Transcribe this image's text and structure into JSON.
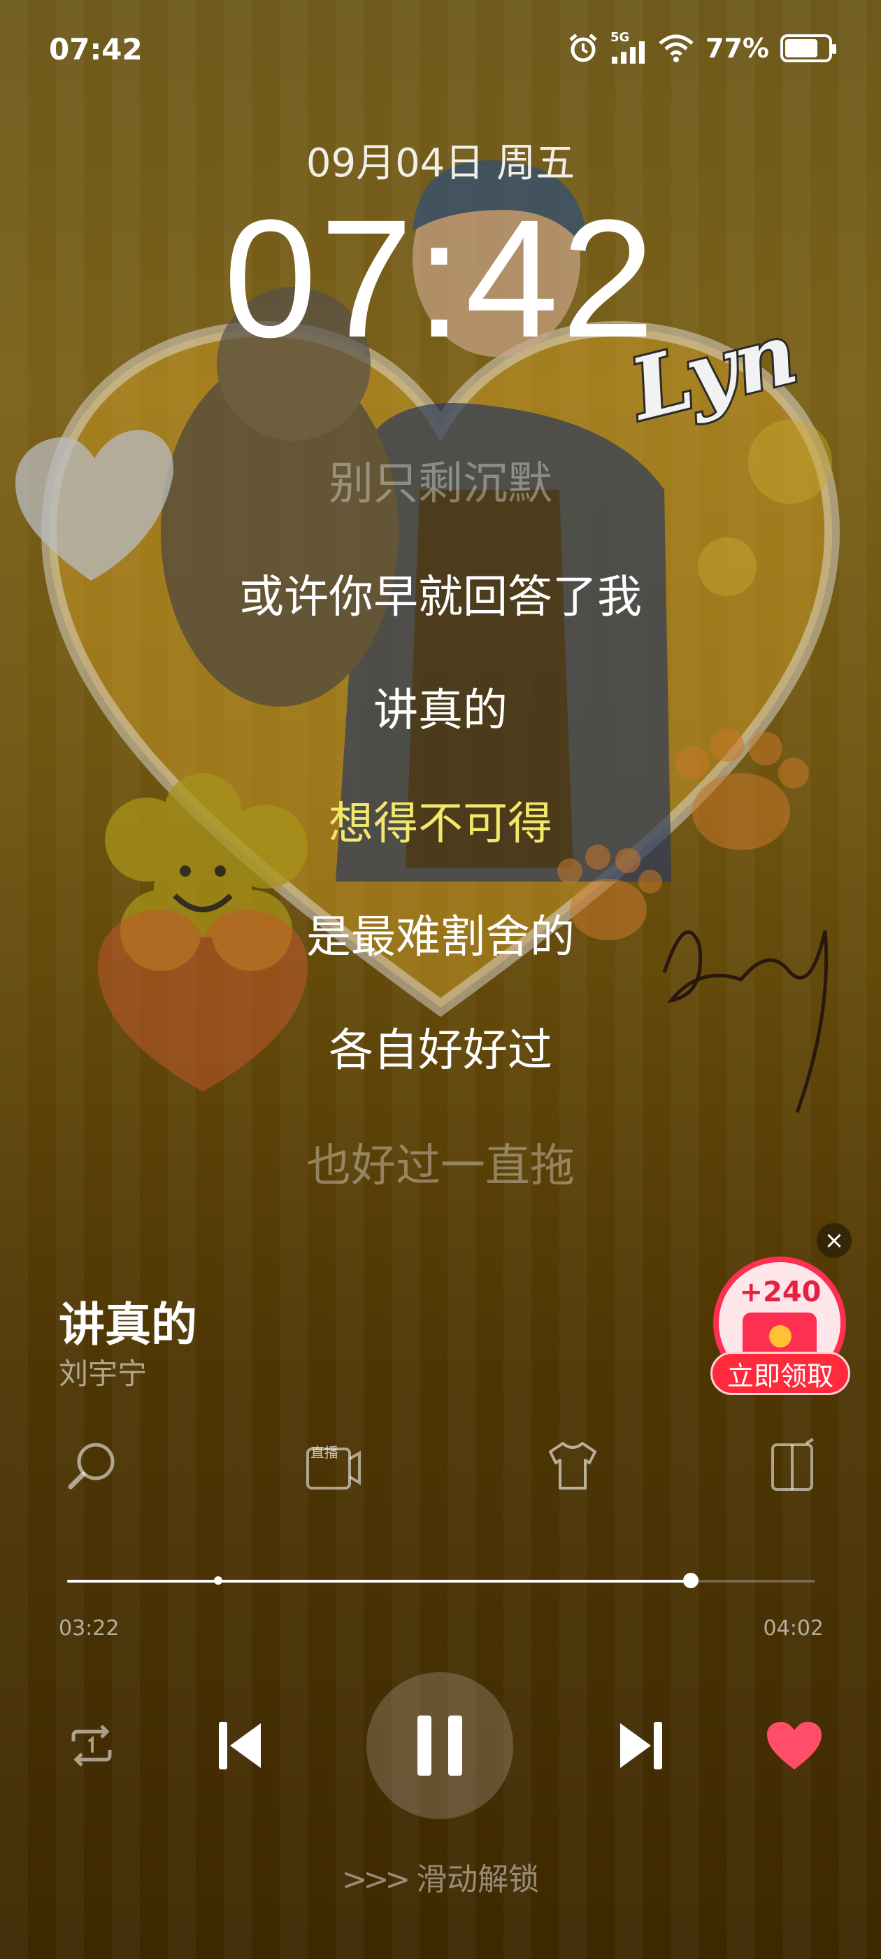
{
  "status_bar": {
    "time": "07:42",
    "network": "5G",
    "battery": "77%",
    "battery_level": 0.77
  },
  "lockscreen": {
    "date": "09月04日 周五",
    "clock": "07:42"
  },
  "album_art": {
    "signature_text": "Lyn"
  },
  "lyrics": [
    {
      "text": "别只剩沉默",
      "state": "dim"
    },
    {
      "text": "或许你早就回答了我",
      "state": "normal"
    },
    {
      "text": "讲真的",
      "state": "normal"
    },
    {
      "text": "想得不可得",
      "state": "active"
    },
    {
      "text": "是最难割舍的",
      "state": "normal"
    },
    {
      "text": "各自好好过",
      "state": "normal"
    },
    {
      "text": "也好过一直拖",
      "state": "dim"
    }
  ],
  "reward": {
    "points": "+240",
    "claim_label": "立即领取",
    "close_symbol": "×"
  },
  "song": {
    "title": "讲真的",
    "artist": "刘宇宁"
  },
  "tools": {
    "live_label": "直播",
    "icons": [
      "search-icon",
      "live-icon",
      "tshirt-icon",
      "device-switch-icon"
    ]
  },
  "progress": {
    "current": "03:22",
    "total": "04:02",
    "fraction": 0.834
  },
  "controls": {
    "icons": [
      "repeat-one-icon",
      "previous-icon",
      "pause-icon",
      "next-icon",
      "heart-icon"
    ],
    "liked_color": "#ff4d6a"
  },
  "unlock": {
    "label": "滑动解锁"
  }
}
